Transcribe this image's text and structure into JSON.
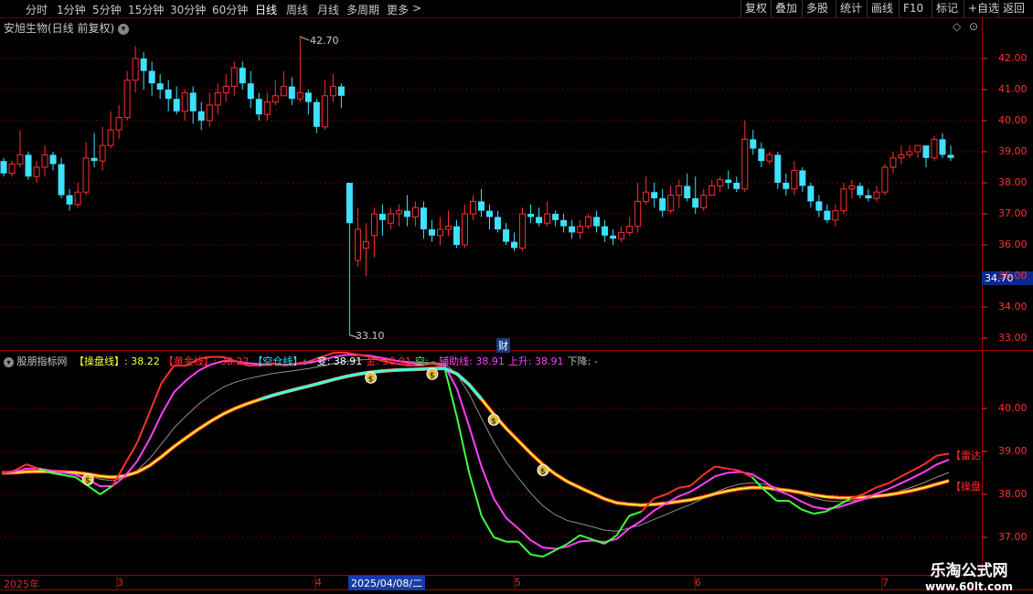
{
  "toolbar": {
    "timeframes": [
      "分时",
      "1分钟",
      "5分钟",
      "15分钟",
      "30分钟",
      "60分钟",
      "日线",
      "周线",
      "月线",
      "多周期",
      "更多"
    ],
    "active_timeframe": "日线",
    "more_arrow": ">",
    "right_buttons": [
      "复权",
      "叠加",
      "多股",
      "统计",
      "画线",
      "F10",
      "标记",
      "+自选",
      "返回"
    ]
  },
  "main_chart": {
    "title": "安旭生物(日线 前复权)",
    "marker_high": "42.70",
    "marker_low": "33.10",
    "event_marker": "财",
    "price_badge": "34.70"
  },
  "indicator": {
    "name": "股朋指标网",
    "items": [
      {
        "label": "【操盘线】",
        "value": ": 38.22",
        "color": "#ffff40"
      },
      {
        "label": "【黄金线】",
        "value": ": 38.22",
        "color": "#ff3030"
      },
      {
        "label": "【空仓线】",
        "value": ": -",
        "color": "#40e0ff"
      },
      {
        "label": "变",
        "value": ": 38.91",
        "color": "#ffffff"
      },
      {
        "label": "金",
        "value": ": 38.91",
        "color": "#ff3030"
      },
      {
        "label": "空",
        "value": ": -",
        "color": "#40ff40"
      },
      {
        "label": "辅助线",
        "value": ": 38.91",
        "color": "#ff40ff"
      },
      {
        "label": "上升",
        "value": ": 38.91",
        "color": "#ff40ff"
      },
      {
        "label": "下降",
        "value": ": -",
        "color": "#c0c0c0"
      }
    ],
    "tag_upper": "【雷达",
    "tag_lower": "【操盘"
  },
  "axes": {
    "price_ticks": [
      "42.00",
      "41.00",
      "40.00",
      "39.00",
      "38.00",
      "37.00",
      "36.00",
      "35.00",
      "34.00",
      "33.00"
    ],
    "indicator_ticks": [
      "40.00",
      "39.00",
      "38.00",
      "37.00"
    ],
    "date_labels": [
      "2025年",
      "3",
      "4",
      "5",
      "6",
      "7"
    ],
    "cursor_date": "2025/04/08/二"
  },
  "watermark": {
    "line1": "乐淘公式网",
    "line2": "www.60lt.com"
  },
  "chart_data": {
    "type": "candlestick",
    "title": "安旭生物(日线 前复权)",
    "candles": [
      [
        38.7,
        38.3,
        38.8,
        38.2
      ],
      [
        38.3,
        38.6,
        38.7,
        38.2
      ],
      [
        38.6,
        38.9,
        39.7,
        38.5
      ],
      [
        38.9,
        38.2,
        39.0,
        38.1
      ],
      [
        38.2,
        38.5,
        38.7,
        38.0
      ],
      [
        38.5,
        38.9,
        39.2,
        38.2
      ],
      [
        38.9,
        38.6,
        39.0,
        38.4
      ],
      [
        38.6,
        37.6,
        38.8,
        37.5
      ],
      [
        37.6,
        37.3,
        37.8,
        37.1
      ],
      [
        37.3,
        37.7,
        38.0,
        37.2
      ],
      [
        37.7,
        38.8,
        39.3,
        37.6
      ],
      [
        38.8,
        38.7,
        39.6,
        38.5
      ],
      [
        38.7,
        39.2,
        39.8,
        38.4
      ],
      [
        39.2,
        39.7,
        40.3,
        39.1
      ],
      [
        39.7,
        40.1,
        40.5,
        39.4
      ],
      [
        40.1,
        41.3,
        41.6,
        40.0
      ],
      [
        41.3,
        42.0,
        42.4,
        40.9
      ],
      [
        42.0,
        41.6,
        42.2,
        41.0
      ],
      [
        41.6,
        41.2,
        41.9,
        40.8
      ],
      [
        41.2,
        41.0,
        41.5,
        40.7
      ],
      [
        41.0,
        40.7,
        41.3,
        40.3
      ],
      [
        40.7,
        40.3,
        41.1,
        40.2
      ],
      [
        40.3,
        40.9,
        41.0,
        40.0
      ],
      [
        40.9,
        40.3,
        41.1,
        39.9
      ],
      [
        40.3,
        40.0,
        40.6,
        39.7
      ],
      [
        40.0,
        40.5,
        40.9,
        39.8
      ],
      [
        40.5,
        40.9,
        41.2,
        40.2
      ],
      [
        40.9,
        41.1,
        41.5,
        40.6
      ],
      [
        41.1,
        41.7,
        41.9,
        40.8
      ],
      [
        41.7,
        41.2,
        41.9,
        41.0
      ],
      [
        41.2,
        40.7,
        41.6,
        40.4
      ],
      [
        40.7,
        40.2,
        40.9,
        40.0
      ],
      [
        40.2,
        40.6,
        40.9,
        40.0
      ],
      [
        40.6,
        40.8,
        41.3,
        40.5
      ],
      [
        40.8,
        41.1,
        41.6,
        40.8
      ],
      [
        41.1,
        40.7,
        41.4,
        40.5
      ],
      [
        40.7,
        40.9,
        42.7,
        40.6
      ],
      [
        40.9,
        40.6,
        41.0,
        40.2
      ],
      [
        40.6,
        39.8,
        40.7,
        39.6
      ],
      [
        39.8,
        40.8,
        41.3,
        39.7
      ],
      [
        40.8,
        41.1,
        41.5,
        40.6
      ],
      [
        41.1,
        40.8,
        41.2,
        40.4
      ],
      [
        38.0,
        36.7,
        38.0,
        33.1
      ],
      [
        35.5,
        36.5,
        37.2,
        35.3
      ],
      [
        35.9,
        36.1,
        36.7,
        35.0
      ],
      [
        36.3,
        37.0,
        37.2,
        35.6
      ],
      [
        37.0,
        36.8,
        37.3,
        36.3
      ],
      [
        36.7,
        37.0,
        37.2,
        36.5
      ],
      [
        37.0,
        37.1,
        37.3,
        36.6
      ],
      [
        37.1,
        36.9,
        37.6,
        36.6
      ],
      [
        36.9,
        37.2,
        37.4,
        36.6
      ],
      [
        37.2,
        36.5,
        37.4,
        36.2
      ],
      [
        36.5,
        36.3,
        36.8,
        36.1
      ],
      [
        36.3,
        36.5,
        36.9,
        36.0
      ],
      [
        36.5,
        36.6,
        37.1,
        36.3
      ],
      [
        36.6,
        36.0,
        36.8,
        35.9
      ],
      [
        36.0,
        37.0,
        37.3,
        35.9
      ],
      [
        37.0,
        37.4,
        37.6,
        36.8
      ],
      [
        37.4,
        37.1,
        37.8,
        36.9
      ],
      [
        37.1,
        36.9,
        37.3,
        36.5
      ],
      [
        36.9,
        36.5,
        37.1,
        36.4
      ],
      [
        36.5,
        36.1,
        36.7,
        36.0
      ],
      [
        36.1,
        35.9,
        36.4,
        35.8
      ],
      [
        35.9,
        37.0,
        37.2,
        35.8
      ],
      [
        37.0,
        36.9,
        37.3,
        36.7
      ],
      [
        36.9,
        36.7,
        37.2,
        36.6
      ],
      [
        36.7,
        37.0,
        37.4,
        36.6
      ],
      [
        37.0,
        36.8,
        37.1,
        36.6
      ],
      [
        36.8,
        36.6,
        37.0,
        36.4
      ],
      [
        36.6,
        36.4,
        36.8,
        36.2
      ],
      [
        36.4,
        36.6,
        36.8,
        36.2
      ],
      [
        36.6,
        36.9,
        37.0,
        36.5
      ],
      [
        36.9,
        36.6,
        37.1,
        36.4
      ],
      [
        36.6,
        36.3,
        36.8,
        36.1
      ],
      [
        36.3,
        36.2,
        36.5,
        36.0
      ],
      [
        36.2,
        36.4,
        36.6,
        36.1
      ],
      [
        36.4,
        36.6,
        36.9,
        36.3
      ],
      [
        36.6,
        37.4,
        38.0,
        36.4
      ],
      [
        37.4,
        37.7,
        38.2,
        37.3
      ],
      [
        37.7,
        37.5,
        38.0,
        37.2
      ],
      [
        37.5,
        37.1,
        37.8,
        36.9
      ],
      [
        37.1,
        37.6,
        37.9,
        37.0
      ],
      [
        37.6,
        37.9,
        38.1,
        37.2
      ],
      [
        37.9,
        37.5,
        38.3,
        37.4
      ],
      [
        37.5,
        37.2,
        38.2,
        37.0
      ],
      [
        37.2,
        37.6,
        37.8,
        37.1
      ],
      [
        37.6,
        37.9,
        38.1,
        37.6
      ],
      [
        37.9,
        38.1,
        38.2,
        37.7
      ],
      [
        38.1,
        38.0,
        38.4,
        37.8
      ],
      [
        38.0,
        37.8,
        38.2,
        37.7
      ],
      [
        37.8,
        39.4,
        40.0,
        37.7
      ],
      [
        39.4,
        39.1,
        39.7,
        38.9
      ],
      [
        39.1,
        38.7,
        39.3,
        38.5
      ],
      [
        38.7,
        38.9,
        39.0,
        38.6
      ],
      [
        38.9,
        38.0,
        39.0,
        37.8
      ],
      [
        38.0,
        37.8,
        38.3,
        37.6
      ],
      [
        37.8,
        38.4,
        38.7,
        37.6
      ],
      [
        38.4,
        37.9,
        38.5,
        37.7
      ],
      [
        37.9,
        37.4,
        38.0,
        37.2
      ],
      [
        37.4,
        37.1,
        37.6,
        36.9
      ],
      [
        37.1,
        36.8,
        37.3,
        36.7
      ],
      [
        36.8,
        37.1,
        37.3,
        36.6
      ],
      [
        37.1,
        37.8,
        38.0,
        37.0
      ],
      [
        37.8,
        37.9,
        38.1,
        37.5
      ],
      [
        37.9,
        37.6,
        38.0,
        37.5
      ],
      [
        37.6,
        37.5,
        37.8,
        37.4
      ],
      [
        37.5,
        37.7,
        37.9,
        37.4
      ],
      [
        37.7,
        38.5,
        38.6,
        37.6
      ],
      [
        38.5,
        38.8,
        39.0,
        38.3
      ],
      [
        38.8,
        38.9,
        39.2,
        38.6
      ],
      [
        38.9,
        39.0,
        39.2,
        38.8
      ],
      [
        39.0,
        39.2,
        39.2,
        38.8
      ],
      [
        39.2,
        38.8,
        39.0,
        38.5
      ],
      [
        38.8,
        39.4,
        39.5,
        38.7
      ],
      [
        39.4,
        38.9,
        39.6,
        38.8
      ],
      [
        38.9,
        38.8,
        39.2,
        38.7
      ]
    ],
    "indicator_series": {
      "golden": [
        38.5,
        38.55,
        38.7,
        38.6,
        38.5,
        38.45,
        38.4,
        38.2,
        38.0,
        38.2,
        38.7,
        39.2,
        39.9,
        40.6,
        41.0,
        41.0,
        41.15,
        41.2,
        41.2,
        41.1,
        41.0,
        41.0,
        41.05,
        41.0,
        41.05,
        41.1,
        41.2,
        41.3,
        41.3,
        41.25,
        41.2,
        41.1,
        41.05,
        41.0,
        41.0,
        41.05,
        40.95,
        39.8,
        38.5,
        37.5,
        37.0,
        36.9,
        36.9,
        36.6,
        36.55,
        36.7,
        36.85,
        37.05,
        36.95,
        36.85,
        37.05,
        37.5,
        37.6,
        37.9,
        38.0,
        38.15,
        38.2,
        38.45,
        38.65,
        38.6,
        38.55,
        38.4,
        38.1,
        37.85,
        37.85,
        37.65,
        37.55,
        37.6,
        37.75,
        37.9,
        38.0,
        38.15,
        38.25,
        38.4,
        38.55,
        38.7,
        38.9,
        38.95
      ]
    }
  }
}
